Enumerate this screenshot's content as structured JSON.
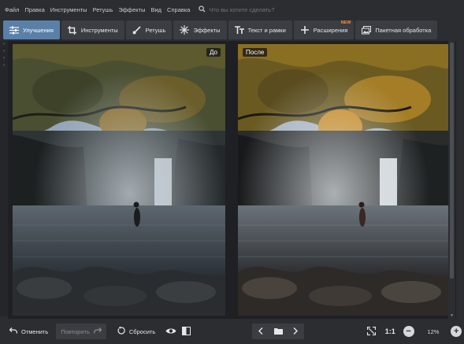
{
  "menu": {
    "items": [
      "Файл",
      "Правка",
      "Инструменты",
      "Ретушь",
      "Эффекты",
      "Вид",
      "Справка"
    ],
    "search_placeholder": "Что вы хотите сделать?"
  },
  "tabs": [
    {
      "label": "Улучшения",
      "icon": "sliders-icon",
      "active": true
    },
    {
      "label": "Инструменты",
      "icon": "crop-icon",
      "active": false
    },
    {
      "label": "Ретушь",
      "icon": "brush-icon",
      "active": false
    },
    {
      "label": "Эффекты",
      "icon": "sparkle-icon",
      "active": false
    },
    {
      "label": "Текст и рамки",
      "icon": "text-icon",
      "active": false
    },
    {
      "label": "Расширения",
      "icon": "plus-icon",
      "active": false,
      "badge": "NEW"
    },
    {
      "label": "Пакетная обработка",
      "icon": "batch-icon",
      "active": false
    }
  ],
  "compare": {
    "before_label": "До",
    "after_label": "После"
  },
  "bottom": {
    "undo_label": "Отменить",
    "redo_label": "Повторить",
    "reset_label": "Сбросить",
    "ratio_label": "1:1",
    "zoom_value": "12%"
  },
  "colors": {
    "accent": "#5a80a8",
    "badge": "#ff8a2b",
    "background": "#2b2d31"
  }
}
